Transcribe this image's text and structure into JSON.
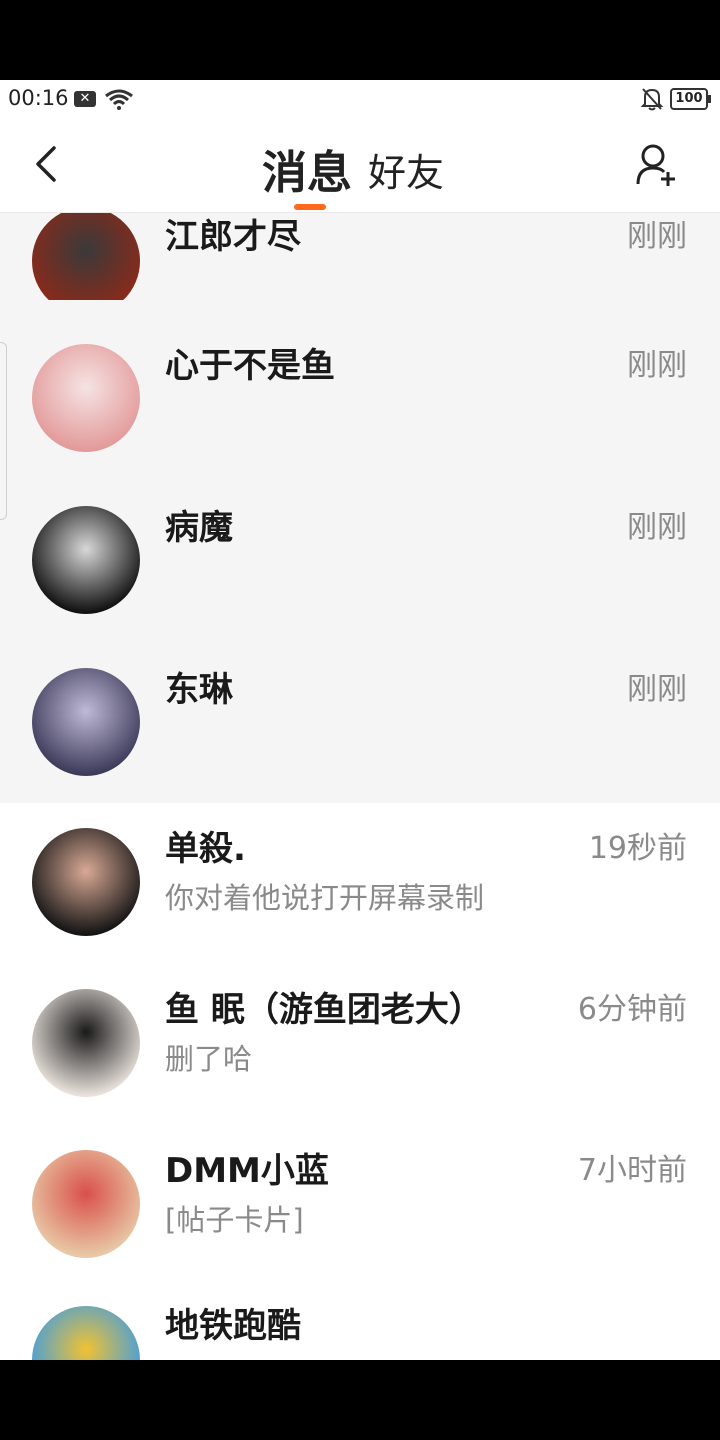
{
  "status_bar": {
    "time": "00:16",
    "battery": "100",
    "x_badge": "✕"
  },
  "nav": {
    "tab_messages": "消息",
    "tab_friends": "好友",
    "accent_color": "#ff6a1a"
  },
  "conversations": [
    {
      "name": "江郎才尽",
      "time": "刚刚",
      "preview": "",
      "avatar_colors": [
        "#8b2a1a",
        "#3a3a3a"
      ]
    },
    {
      "name": "心于不是鱼",
      "time": "刚刚",
      "preview": "",
      "avatar_colors": [
        "#e39a9a",
        "#f6e3e3"
      ]
    },
    {
      "name": "病魔",
      "time": "刚刚",
      "preview": "",
      "avatar_colors": [
        "#111111",
        "#d8d8d8"
      ]
    },
    {
      "name": "东琳",
      "time": "刚刚",
      "preview": "",
      "avatar_colors": [
        "#3d3a5a",
        "#bfbad6"
      ]
    },
    {
      "name": "单殺.",
      "time": "19秒前",
      "preview": "你对着他说打开屏幕录制",
      "avatar_colors": [
        "#151515",
        "#d9a995"
      ]
    },
    {
      "name": "鱼 眠（游鱼团老大）",
      "time": "6分钟前",
      "preview": "删了哈",
      "avatar_colors": [
        "#e9e2dc",
        "#1a1a1a"
      ]
    },
    {
      "name": "DMM小蓝",
      "time": "7小时前",
      "preview": "[帖子卡片]",
      "avatar_colors": [
        "#e8c9a6",
        "#d9504a"
      ]
    },
    {
      "name": "地铁跑酷",
      "time": "",
      "preview": "",
      "avatar_colors": [
        "#3a9be8",
        "#f1c232"
      ]
    }
  ]
}
